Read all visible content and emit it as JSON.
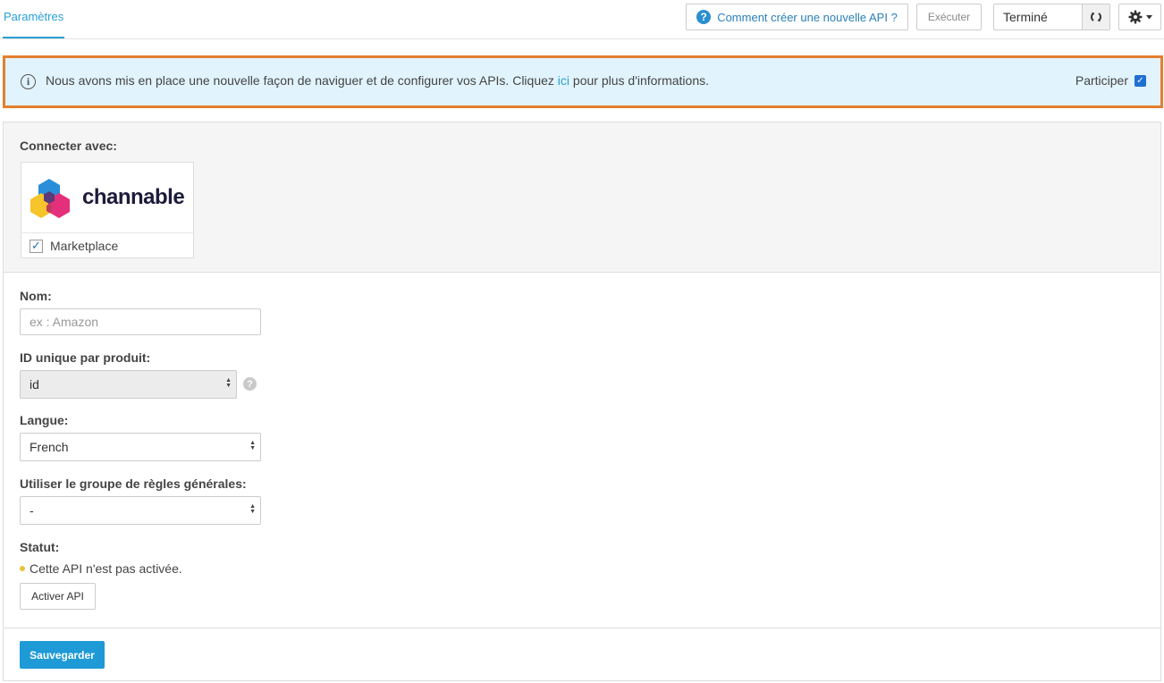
{
  "topbar": {
    "tab_label": "Paramètres",
    "help_label": "Comment créer une nouvelle API ?",
    "exec_label": "Exécuter",
    "status_label": "Terminé"
  },
  "notice": {
    "text_before": "Nous avons mis en place une nouvelle façon de naviguer et de configurer vos APIs. Cliquez ",
    "link": "ici",
    "text_after": " pour plus d'informations.",
    "participate_label": "Participer",
    "participate_checked": true
  },
  "connect": {
    "label": "Connecter avec:",
    "logo_text": "channable",
    "channel_label": "Marketplace",
    "channel_checked": true
  },
  "form": {
    "name_label": "Nom:",
    "name_placeholder": "ex : Amazon",
    "id_label": "ID unique par produit:",
    "id_value": "id",
    "lang_label": "Langue:",
    "lang_value": "French",
    "rules_label": "Utiliser le groupe de règles générales:",
    "rules_value": "-",
    "status_label": "Statut:",
    "status_text": "Cette API n'est pas activée.",
    "activate_label": "Activer API",
    "save_label": "Sauvegarder"
  },
  "colors": {
    "accent": "#2a9fd6",
    "notice_bg": "#e1f3fc",
    "notice_border": "#e27f30",
    "save_btn": "#1e9ad6",
    "status_dot": "#e8c33a"
  }
}
